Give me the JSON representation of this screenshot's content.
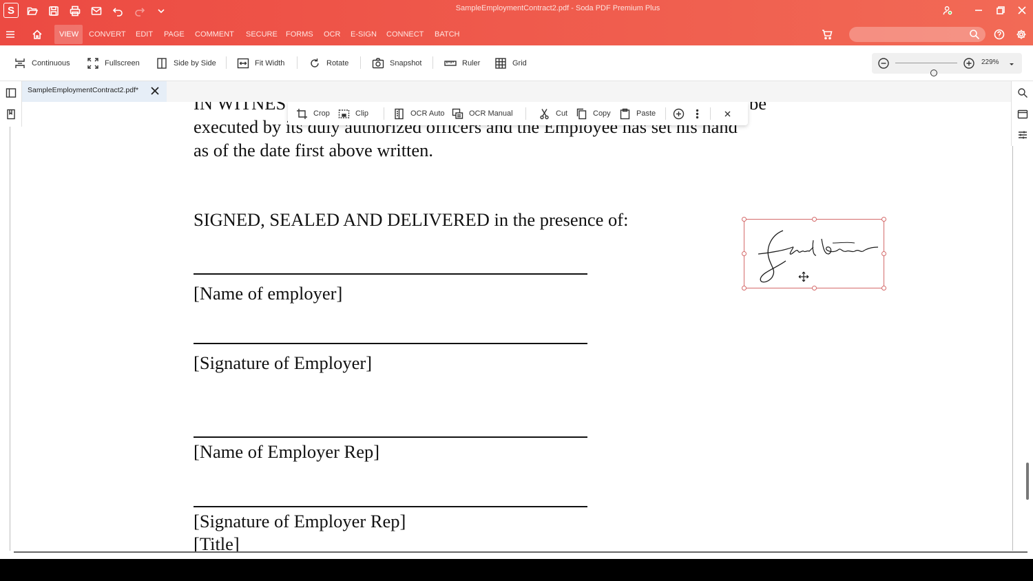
{
  "window": {
    "title": "SampleEmploymentContract2.pdf  -  Soda PDF Premium Plus",
    "logo_letter": "S"
  },
  "menu": {
    "items": [
      "VIEW",
      "CONVERT",
      "EDIT",
      "PAGE",
      "COMMENT",
      "SECURE",
      "FORMS",
      "OCR",
      "E-SIGN",
      "CONNECT",
      "BATCH"
    ],
    "active": "VIEW",
    "search_placeholder": ""
  },
  "toolbar": {
    "continuous": "Continuous",
    "fullscreen": "Fullscreen",
    "side_by_side": "Side by Side",
    "fit_width": "Fit Width",
    "rotate": "Rotate",
    "snapshot": "Snapshot",
    "ruler": "Ruler",
    "grid": "Grid",
    "zoom": "229%",
    "zoom_level_fraction": 0.62
  },
  "tab": {
    "label": "SampleEmploymentContract2.pdf*"
  },
  "context_toolbar": {
    "crop": "Crop",
    "clip": "Clip",
    "ocr_auto": "OCR Auto",
    "ocr_manual": "OCR Manual",
    "cut": "Cut",
    "copy": "Copy",
    "paste": "Paste"
  },
  "document": {
    "line_partial_1": "IN WITNES",
    "line_partial_1_end": "be",
    "line_2": "executed by its duly authorized officers and the Employee has set his hand",
    "line_3": "as of the date first above written.",
    "signed_heading": "SIGNED, SEALED AND DELIVERED in the presence of:",
    "blocks": [
      "[Name of employer]",
      "[Signature of Employer]",
      "[Name of Employer Rep]",
      "[Signature of Employer Rep]",
      "[Title]"
    ]
  },
  "colors": {
    "brand_red": "#ec4a42",
    "selection_border": "#d46a6a"
  }
}
